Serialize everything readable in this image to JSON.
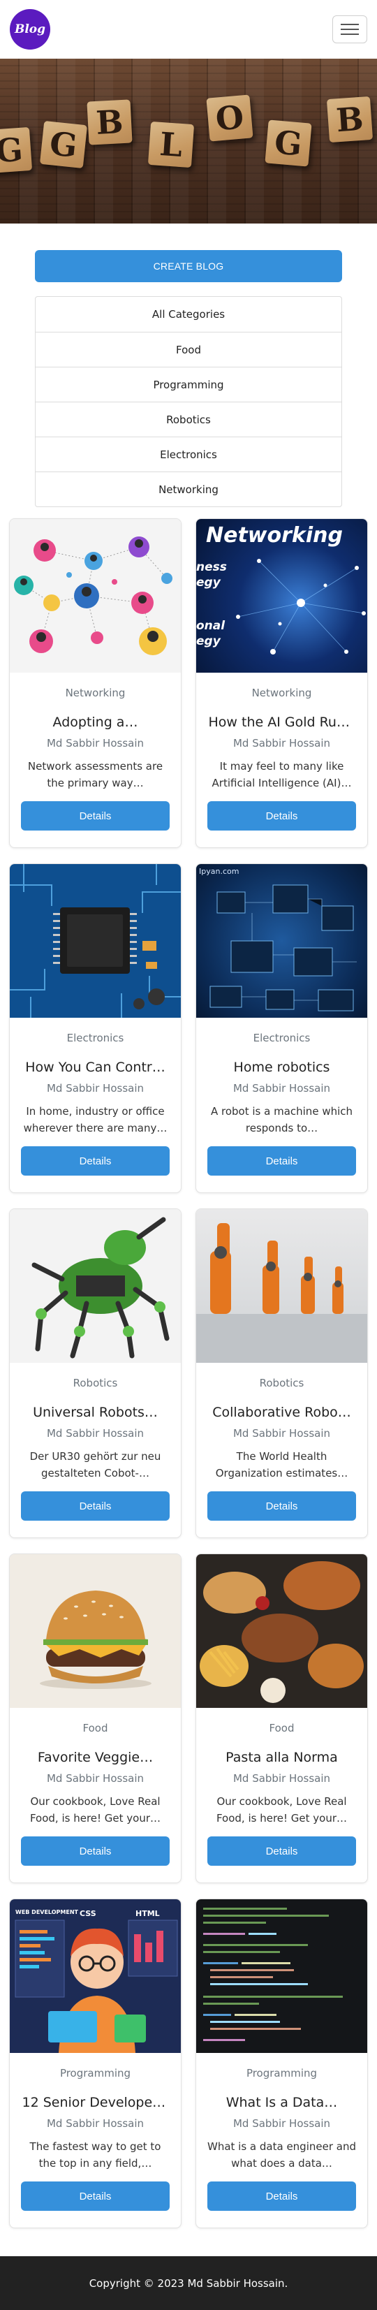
{
  "navbar": {
    "logo_text": "Blog"
  },
  "hero": {
    "tiles": [
      "G",
      "B",
      "L",
      "O",
      "G",
      "B"
    ]
  },
  "create_button": "CREATE BLOG",
  "categories": [
    "All Categories",
    "Food",
    "Programming",
    "Robotics",
    "Electronics",
    "Networking"
  ],
  "cards": [
    {
      "category": "Networking",
      "title": "Adopting a…",
      "author": "Md Sabbir Hossain",
      "description": "Network assessments are the primary way…",
      "button": "Details",
      "image": "network-people"
    },
    {
      "category": "Networking",
      "title": "How the AI Gold Rus…",
      "author": "Md Sabbir Hossain",
      "description": "It may feel to many like Artificial Intelligence (AI)…",
      "button": "Details",
      "image": "networking-banner",
      "image_text": [
        "Networking",
        "ness",
        "egy",
        "onal",
        "egy"
      ]
    },
    {
      "category": "Electronics",
      "title": "How You Can Contr…",
      "author": "Md Sabbir Hossain",
      "description": "In home, industry or office wherever there are many…",
      "button": "Details",
      "image": "circuit-chip"
    },
    {
      "category": "Electronics",
      "title": "Home robotics",
      "author": "Md Sabbir Hossain",
      "description": "A robot is a machine which responds to…",
      "button": "Details",
      "image": "circuit-board",
      "image_text": [
        "Ipyan.com"
      ]
    },
    {
      "category": "Robotics",
      "title": "Universal Robots…",
      "author": "Md Sabbir Hossain",
      "description": "Der UR30 gehört zur neu gestalteten Cobot-…",
      "button": "Details",
      "image": "green-robot"
    },
    {
      "category": "Robotics",
      "title": "Collaborative Robo…",
      "author": "Md Sabbir Hossain",
      "description": "The World Health Organization estimates…",
      "button": "Details",
      "image": "robot-arms"
    },
    {
      "category": "Food",
      "title": "Favorite Veggie…",
      "author": "Md Sabbir Hossain",
      "description": "Our cookbook, Love Real Food, is here! Get your…",
      "button": "Details",
      "image": "burger"
    },
    {
      "category": "Food",
      "title": "Pasta alla Norma",
      "author": "Md Sabbir Hossain",
      "description": "Our cookbook, Love Real Food, is here! Get your…",
      "button": "Details",
      "image": "food-spread"
    },
    {
      "category": "Programming",
      "title": "12 Senior Developer…",
      "author": "Md Sabbir Hossain",
      "description": "The fastest way to get to the top in any field,…",
      "button": "Details",
      "image": "developer-illustration",
      "image_text": [
        "WEB DEVELOPMENT",
        "CSS",
        "HTML"
      ]
    },
    {
      "category": "Programming",
      "title": "What Is a Data…",
      "author": "Md Sabbir Hossain",
      "description": "What is a data engineer and what does a data…",
      "button": "Details",
      "image": "code-screen"
    }
  ],
  "footer": "Copyright © 2023 Md Sabbir Hossain.",
  "colors": {
    "primary": "#3590db",
    "logo_bg": "#5b1bbf",
    "footer_bg": "#222222"
  }
}
